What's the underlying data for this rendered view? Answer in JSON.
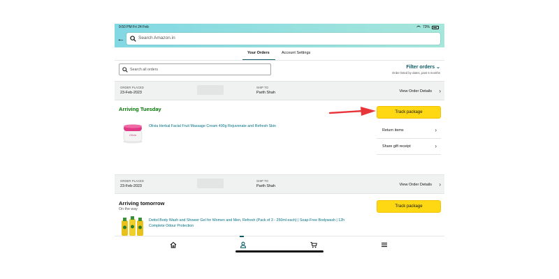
{
  "status": {
    "time": "9:50 PM  Fri 24 Feb",
    "battery": "73%"
  },
  "header": {
    "search_placeholder": "Search Amazon.in"
  },
  "tabs": [
    {
      "label": "Your Orders"
    },
    {
      "label": "Account Settings"
    }
  ],
  "orders_search": {
    "placeholder": "Search all orders"
  },
  "filter": {
    "label": "Filter orders",
    "sublabel": "Order listed by dates, past 6 months"
  },
  "orders": [
    {
      "placed_label": "ORDER PLACED",
      "placed_date": "23-Feb-2023",
      "ship_label": "SHIP TO",
      "ship_name": "Parth Shah",
      "details_link": "View Order Details",
      "arrival": "Arriving Tuesday",
      "arrival_sub": "",
      "track_label": "Track package",
      "product": "Olivia Herbal Facial Fruit Massage Cream 400g Rejuvenate and Refresh Skin",
      "actions": [
        {
          "label": "Return items"
        },
        {
          "label": "Share gift receipt"
        }
      ]
    },
    {
      "placed_label": "ORDER PLACED",
      "placed_date": "23-Feb-2023",
      "ship_label": "SHIP TO",
      "ship_name": "Parth Shah",
      "details_link": "View Order Details",
      "arrival": "Arriving tomorrow",
      "arrival_sub": "On the way",
      "track_label": "Track package",
      "product_line1": "Dettol Body Wash and Shower Gel for Women and Men, Refresh (Pack of 3 - 250ml each) | Soap-Free Bodywash | 12h",
      "product_line2": "Complete Odour Protection"
    }
  ],
  "colors": {
    "accent": "#0c5b66",
    "track_button": "#ffd814",
    "arrival_green": "#007600",
    "link": "#007185",
    "annotation_arrow": "#e8353a"
  }
}
